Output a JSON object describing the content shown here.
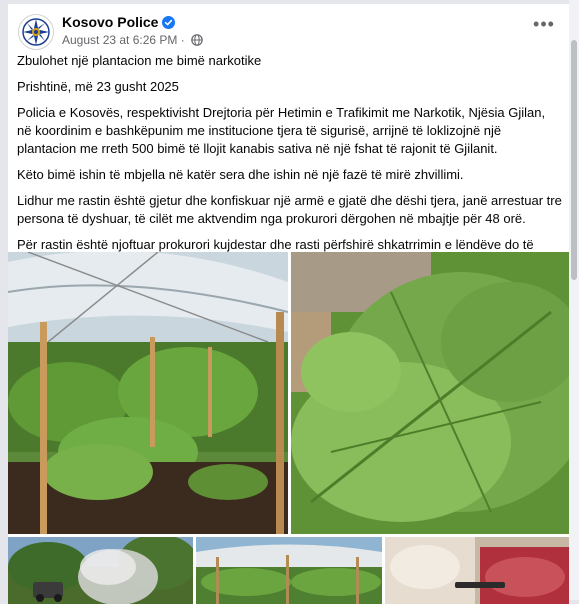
{
  "post": {
    "page_name": "Kosovo Police",
    "timestamp": "August 23 at 6:26 PM",
    "separator": "·",
    "more_label": "•••",
    "paragraphs": [
      "Zbulohet një plantacion me bimë narkotike",
      "Prishtinë, më 23 gusht 2025",
      "Policia e Kosovës, respektivisht Drejtoria për Hetimin e Trafikimit me Narkotik, Njësia Gjilan, në koordinim e bashkëpunim me institucione tjera të sigurisë, arrijnë të loklizojnë një plantacion me rreth 500 bimë të llojit kanabis sativa në një fshat të rajonit të Gjilanit.",
      "Këto bimë ishin të mbjella në katër sera dhe ishin në një fazë të mirë zhvillimi.",
      "Lidhur me rastin është gjetur dhe konfiskuar një armë e gjatë dhe dëshi tjera, janë arrestuar tre persona të dyshuar, të cilët me aktvendim nga prokurori dërgohen në mbajtje për 48 orë.",
      "Për rastin është njoftuar prokurori kujdestar dhe rasti përfshirë shkatrrimin e lëndëve do të bëhet në koordinim me këto organe."
    ]
  },
  "icons": {
    "avatar": "police-emblem-icon",
    "verified": "verified-badge-icon",
    "privacy": "globe-icon",
    "more": "more-options-icon"
  },
  "colors": {
    "verified_blue": "#1877f2",
    "meta_gray": "#65676b",
    "text": "#050505"
  },
  "photos": [
    "greenhouse-plants-photo",
    "harvested-cannabis-photo",
    "burning-plants-photo",
    "greenhouse-rows-photo",
    "confiscated-items-photo"
  ]
}
